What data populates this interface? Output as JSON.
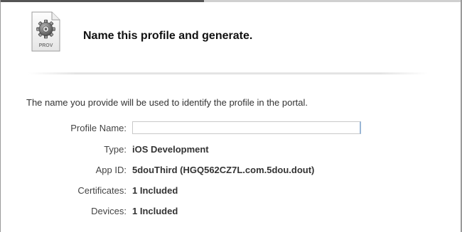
{
  "header": {
    "icon_label": "PROV",
    "title": "Name this profile and generate."
  },
  "intro_text": "The name you provide will be used to identify the profile in the portal.",
  "form": {
    "profile_name": {
      "label": "Profile Name:",
      "value": "",
      "placeholder": ""
    },
    "type": {
      "label": "Type:",
      "value": "iOS Development"
    },
    "app_id": {
      "label": "App ID:",
      "value": "5douThird (HGQ562CZ7L.com.5dou.dout)"
    },
    "certificates": {
      "label": "Certificates:",
      "value": "1 Included"
    },
    "devices": {
      "label": "Devices:",
      "value": "1 Included"
    }
  },
  "icons": {
    "profile_icon": "provisioning-profile-icon",
    "gear": "gear-icon"
  },
  "colors": {
    "title_text": "#111111",
    "body_text": "#333333",
    "input_border": "#c9c9c9",
    "input_focus_edge": "#9ab6d6"
  }
}
